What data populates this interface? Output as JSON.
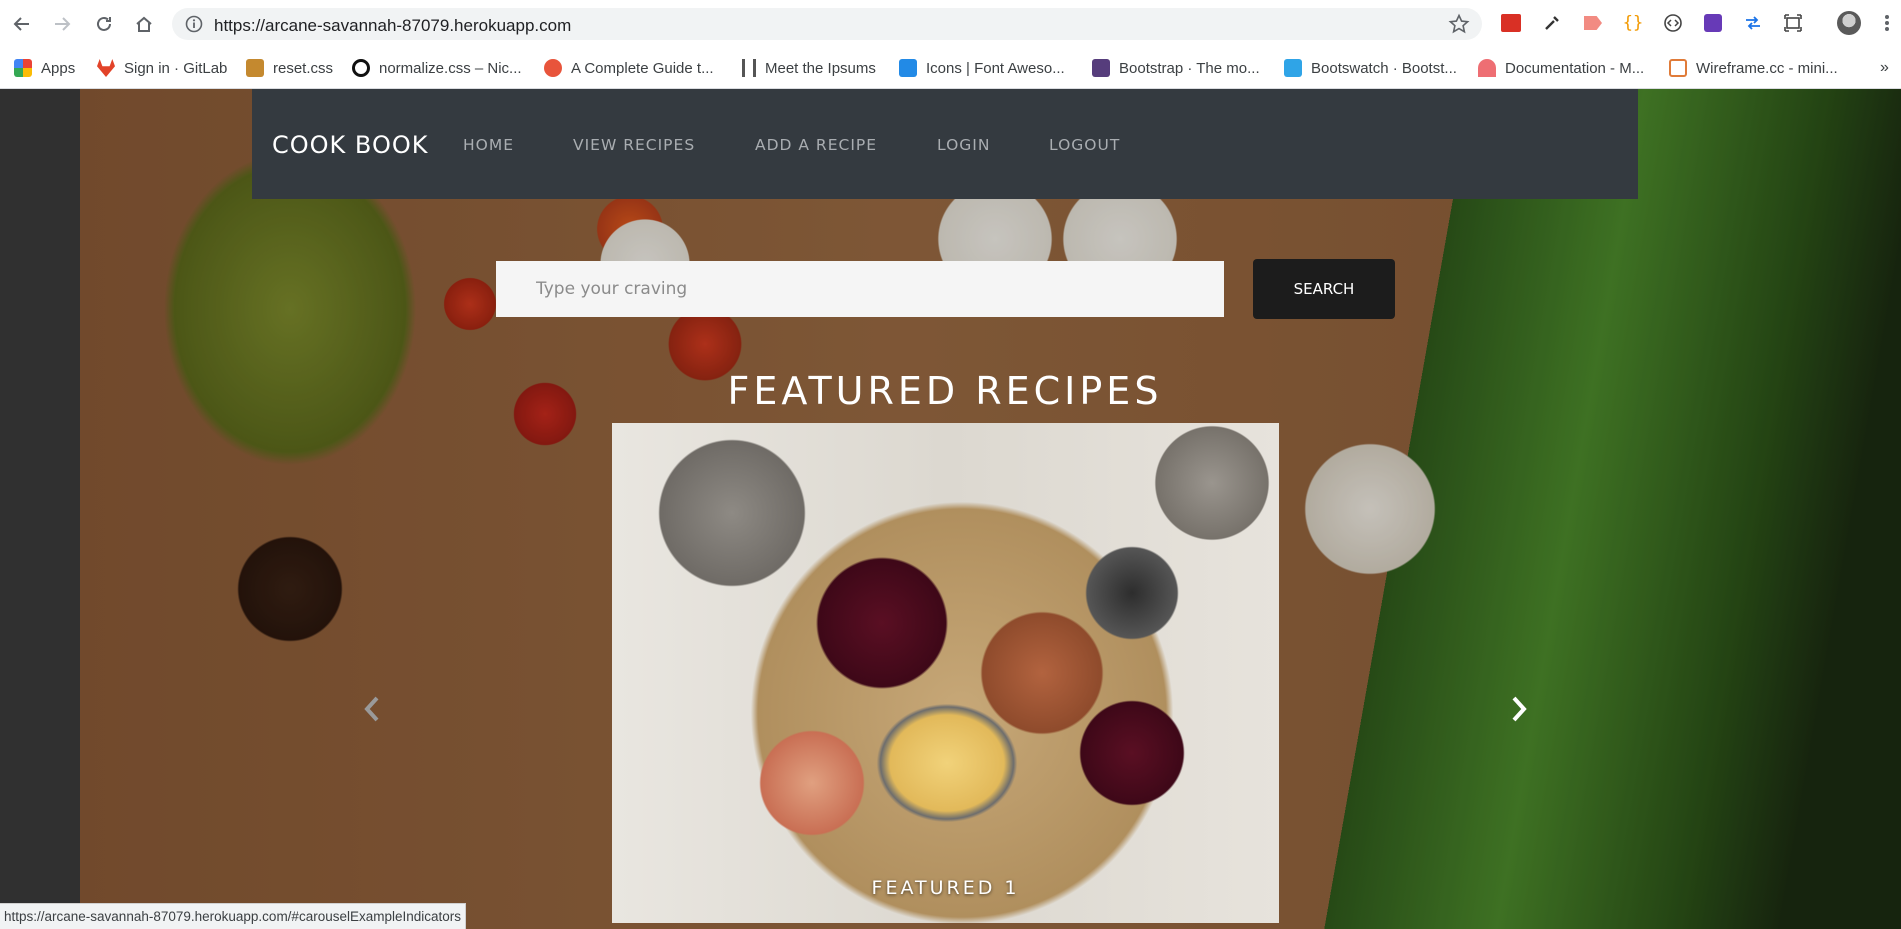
{
  "browser": {
    "url": "https://arcane-savannah-87079.herokuapp.com",
    "bookmarks": [
      {
        "label": "Apps",
        "icon": "apps-grid-icon",
        "color": "#ea4335"
      },
      {
        "label": "Sign in · GitLab",
        "icon": "gitlab-icon",
        "color": "#e24329"
      },
      {
        "label": "reset.css",
        "icon": "reset-css-icon",
        "color": "#c4892f"
      },
      {
        "label": "normalize.css – Nic...",
        "icon": "normalize-icon",
        "color": "#111111"
      },
      {
        "label": "A Complete Guide t...",
        "icon": "css-tricks-icon",
        "color": "#e8543b"
      },
      {
        "label": "Meet the Ipsums",
        "icon": "ipsums-icon",
        "color": "#555555"
      },
      {
        "label": "Icons | Font Aweso...",
        "icon": "font-awesome-icon",
        "color": "#228ae6"
      },
      {
        "label": "Bootstrap · The mo...",
        "icon": "bootstrap-icon",
        "color": "#563d7c"
      },
      {
        "label": "Bootswatch · Bootst...",
        "icon": "bootswatch-icon",
        "color": "#2fa4e7"
      },
      {
        "label": "Documentation - M...",
        "icon": "materialize-icon",
        "color": "#ee6e73"
      },
      {
        "label": "Wireframe.cc - mini...",
        "icon": "wireframe-icon",
        "color": "#e07b39"
      }
    ],
    "status_url": "https://arcane-savannah-87079.herokuapp.com/#carouselExampleIndicators"
  },
  "navbar": {
    "brand": "COOK BOOK",
    "links": [
      "HOME",
      "VIEW RECIPES",
      "ADD A RECIPE",
      "LOGIN",
      "LOGOUT"
    ]
  },
  "search": {
    "placeholder": "Type your craving",
    "button_label": "SEARCH"
  },
  "featured": {
    "title": "FEATURED RECIPES",
    "caption": "FEATURED 1"
  },
  "colors": {
    "navbar_bg": "#343a40",
    "search_button_bg": "#1c1c1c"
  }
}
